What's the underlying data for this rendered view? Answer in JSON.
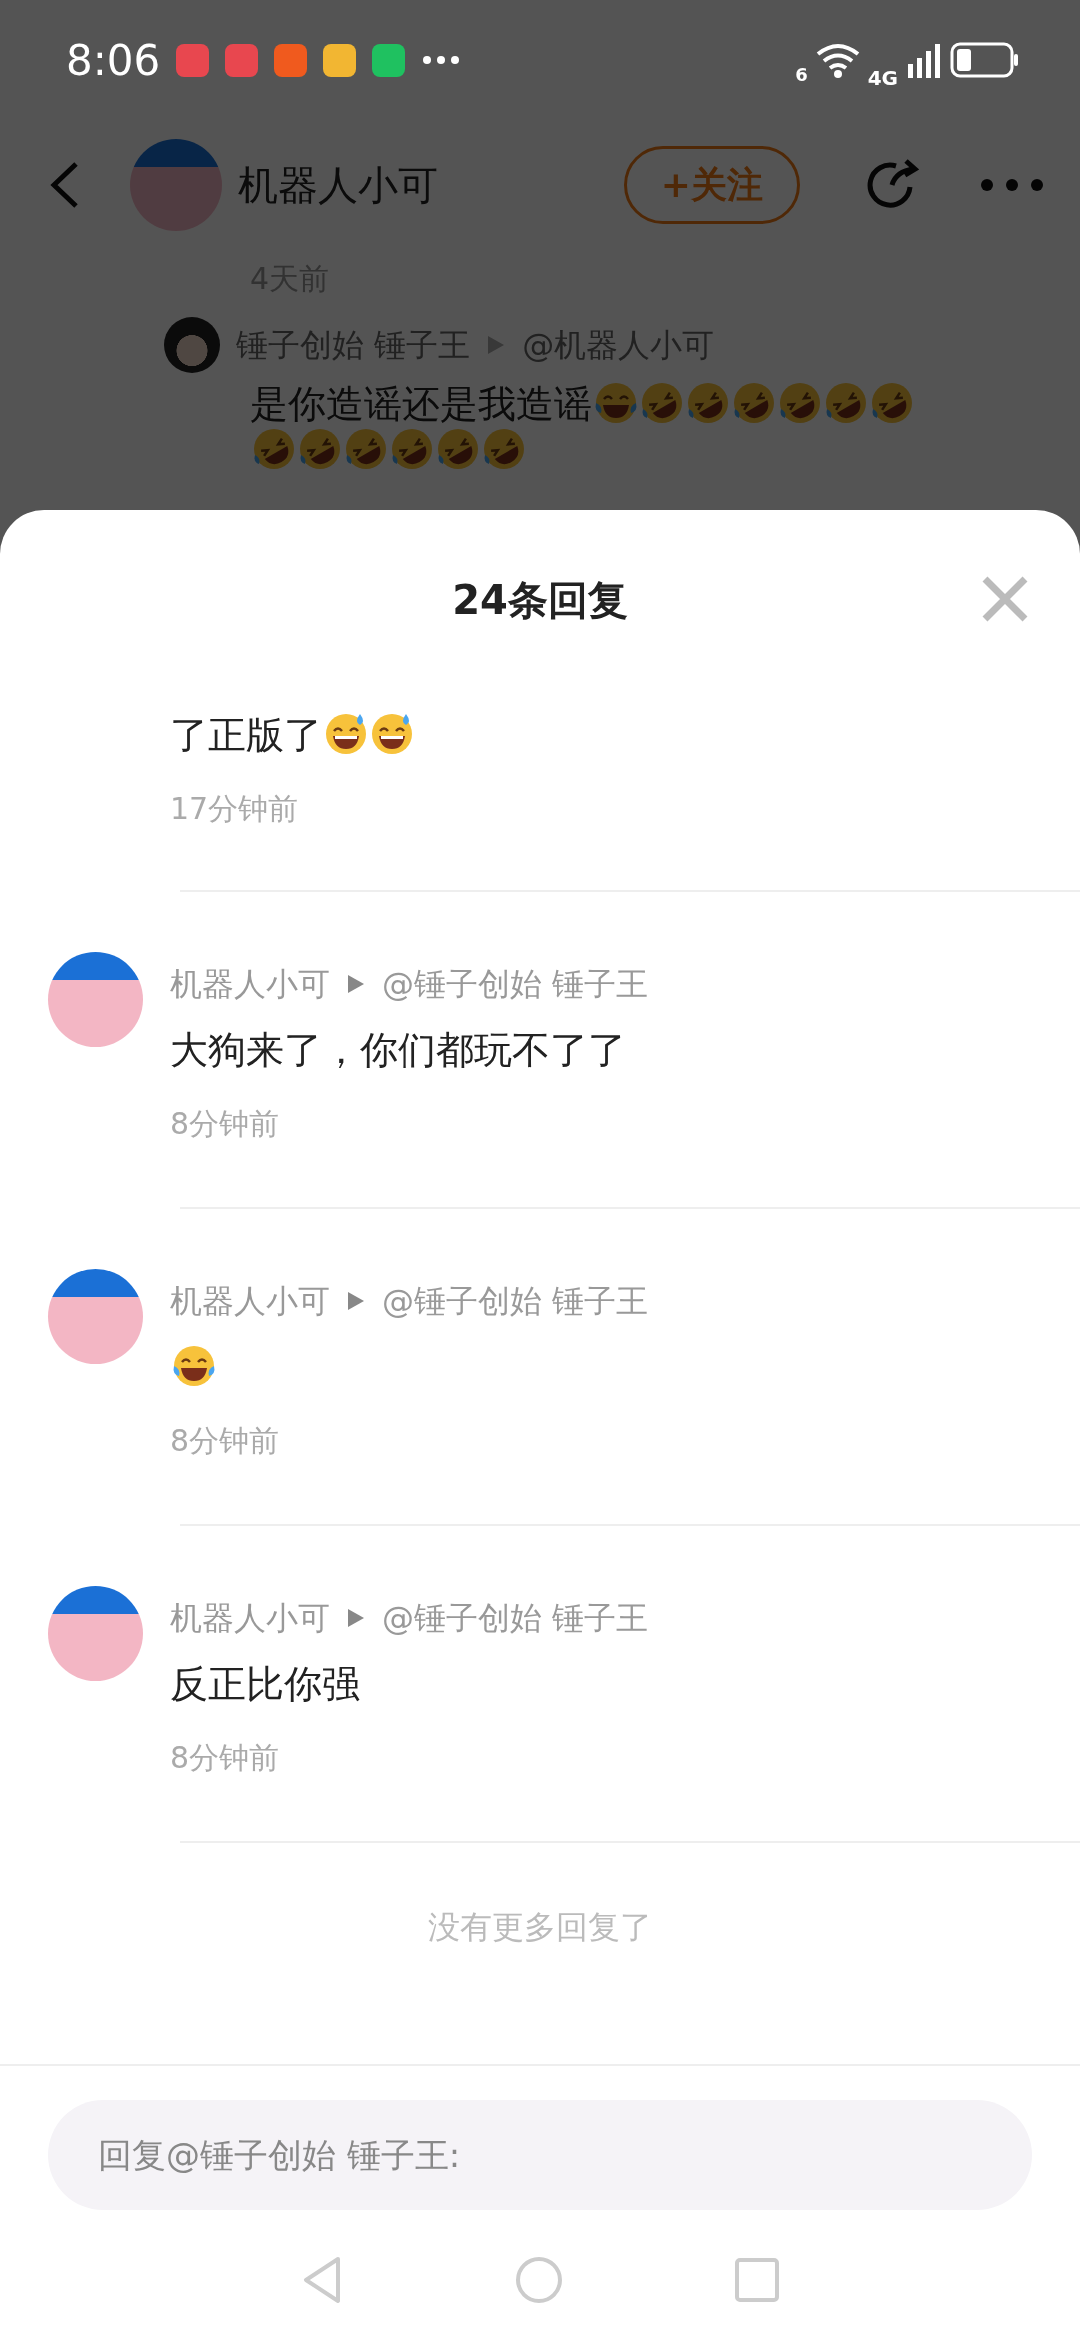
{
  "status_bar": {
    "time": "8:06",
    "apps": [
      {
        "color": "#e8474f"
      },
      {
        "color": "#e8474f"
      },
      {
        "color": "#f05a1e"
      },
      {
        "color": "#f2b632"
      },
      {
        "color": "#1fc160"
      }
    ],
    "wifi_label": "6",
    "network_label": "4G"
  },
  "header": {
    "name": "机器人小可",
    "follow_label": "+关注"
  },
  "post": {
    "time": "4天前",
    "comment": {
      "author": "锤子创始 锤子王",
      "reply_to": "@机器人小可",
      "text": "是你造谣还是我造谣",
      "emojis": [
        {
          "kind": "joy"
        },
        {
          "kind": "rofl"
        },
        {
          "kind": "rofl"
        },
        {
          "kind": "rofl"
        },
        {
          "kind": "rofl"
        },
        {
          "kind": "rofl"
        },
        {
          "kind": "rofl"
        },
        {
          "kind": "rofl"
        },
        {
          "kind": "rofl"
        },
        {
          "kind": "rofl"
        },
        {
          "kind": "rofl"
        },
        {
          "kind": "rofl"
        },
        {
          "kind": "rofl"
        }
      ]
    }
  },
  "sheet": {
    "title": "24条回复",
    "replies": [
      {
        "text": "了正版了",
        "emojis": [
          {
            "kind": "sweat_smile"
          },
          {
            "kind": "sweat_smile"
          }
        ],
        "time": "17分钟前"
      },
      {
        "author": "机器人小可",
        "reply_to": "@锤子创始 锤子王",
        "text": "大狗来了，你们都玩不了了",
        "time": "8分钟前"
      },
      {
        "author": "机器人小可",
        "reply_to": "@锤子创始 锤子王",
        "emojis": [
          {
            "kind": "joy"
          }
        ],
        "time": "8分钟前"
      },
      {
        "author": "机器人小可",
        "reply_to": "@锤子创始 锤子王",
        "text": "反正比你强",
        "time": "8分钟前"
      }
    ],
    "end_text": "没有更多回复了",
    "input": {
      "placeholder": "回复@锤子创始 锤子王:"
    }
  }
}
